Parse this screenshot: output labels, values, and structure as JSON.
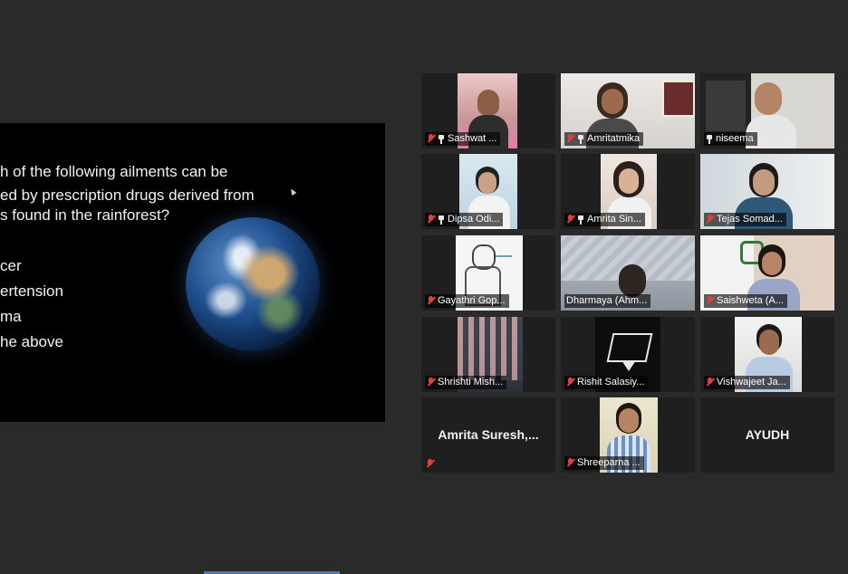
{
  "slide": {
    "question_lines": [
      "h of the following ailments can be",
      "ed by prescription drugs derived from",
      "s found in the rainforest?"
    ],
    "options": [
      "cer",
      "ertension",
      "ma",
      "he above"
    ]
  },
  "participants": [
    {
      "name": "Sashwat ...",
      "muted": true,
      "pinned": true
    },
    {
      "name": "Amritatmika",
      "muted": true,
      "pinned": true
    },
    {
      "name": "niseema",
      "muted": false,
      "pinned": true,
      "active": true
    },
    {
      "name": "Dipsa Odi...",
      "muted": true,
      "pinned": true
    },
    {
      "name": "Amrita Sin...",
      "muted": true,
      "pinned": true
    },
    {
      "name": "Tejas Somad...",
      "muted": true,
      "pinned": false
    },
    {
      "name": "Gayathri Gop...",
      "muted": true,
      "pinned": false
    },
    {
      "name": "Dharmaya (Ahm...",
      "muted": false,
      "pinned": false
    },
    {
      "name": "Saishweta (A...",
      "muted": true,
      "pinned": false
    },
    {
      "name": "Shrishti Mish...",
      "muted": true,
      "pinned": false
    },
    {
      "name": "Rishit Salasiy...",
      "muted": true,
      "pinned": false
    },
    {
      "name": "Vishwajeet Ja...",
      "muted": true,
      "pinned": false
    },
    {
      "name": "Amrita  Suresh,...",
      "muted": true,
      "pinned": false,
      "no_video": true
    },
    {
      "name": "Shreeparna ...",
      "muted": true,
      "pinned": false
    },
    {
      "name": "AYUDH",
      "muted": false,
      "pinned": false,
      "no_video": true
    }
  ],
  "colors": {
    "background": "#2a2a2a",
    "tile": "#1f1f1f",
    "active_speaker_border": "#d7d74a",
    "muted_mic": "#e0413b"
  }
}
